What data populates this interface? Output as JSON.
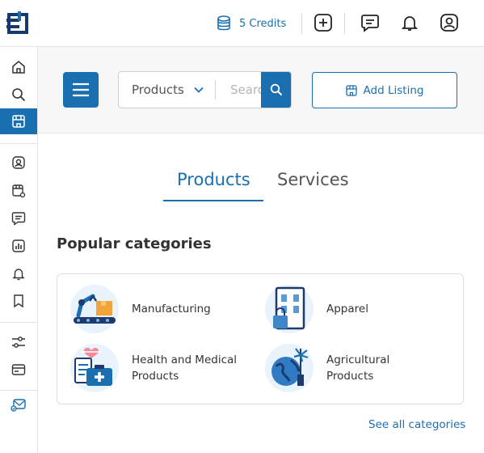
{
  "topbar": {
    "credits_label": "5 Credits",
    "icons": [
      "database-icon",
      "add-square-icon",
      "chat-icon",
      "bell-icon",
      "user-icon"
    ]
  },
  "sidebar": {
    "items": [
      {
        "name": "home-icon",
        "active": false
      },
      {
        "name": "search-icon",
        "active": false
      },
      {
        "name": "storefront-icon",
        "active": true
      },
      {
        "name": "profile-icon",
        "active": false
      },
      {
        "name": "store-settings-icon",
        "active": false
      },
      {
        "name": "messages-icon",
        "active": false
      },
      {
        "name": "analytics-icon",
        "active": false
      },
      {
        "name": "notifications-icon",
        "active": false
      },
      {
        "name": "bookmark-icon",
        "active": false
      },
      {
        "name": "filters-icon",
        "active": false
      },
      {
        "name": "billing-icon",
        "active": false
      },
      {
        "name": "mail-check-icon",
        "active": false
      }
    ]
  },
  "search": {
    "category_value": "Products",
    "placeholder": "Search"
  },
  "add_listing": {
    "label": "Add Listing"
  },
  "tabs": [
    {
      "label": "Products",
      "active": true
    },
    {
      "label": "Services",
      "active": false
    }
  ],
  "popular": {
    "title": "Popular categories",
    "categories": [
      {
        "label": "Manufacturing",
        "icon": "robot-arm-icon"
      },
      {
        "label": "Apparel",
        "icon": "clothing-rack-icon"
      },
      {
        "label": "Health and Medical Products",
        "icon": "medical-kit-icon"
      },
      {
        "label": "Agricultural Products",
        "icon": "globe-windmill-icon"
      }
    ],
    "see_all": "See all categories"
  },
  "colors": {
    "accent": "#1a6fb0",
    "band_bg": "#f7f7f7",
    "icon_bg": "#e8f3fb"
  }
}
